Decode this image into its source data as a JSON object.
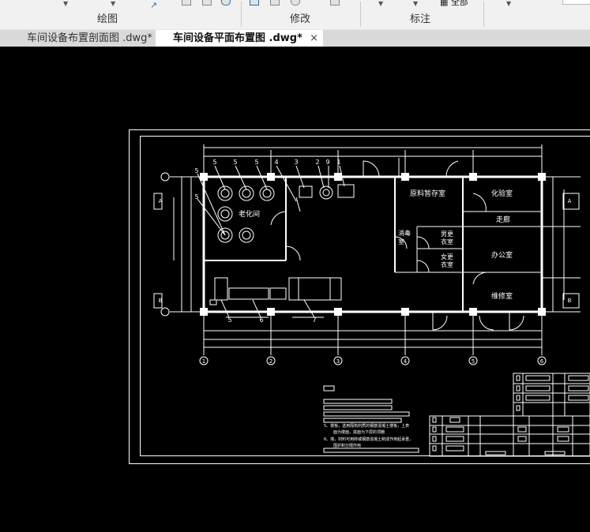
{
  "ribbon": {
    "groups": [
      {
        "label": "绘图"
      },
      {
        "label": "修改"
      },
      {
        "label": "标注"
      }
    ],
    "partial_text": "全部"
  },
  "tabs": [
    {
      "label": "车间设备布置剖面图 .dwg*",
      "active": false
    },
    {
      "label": "车间设备平面布置图 .dwg*",
      "active": true
    }
  ],
  "close_glyph": "×",
  "drawing": {
    "rooms": {
      "aging": "老化间",
      "raw_storage": "原料暂存室",
      "lab": "化验室",
      "corridor": "走廊",
      "disinfect": "消毒\n室",
      "male_changing": "男更\n衣室",
      "female_changing": "女更\n衣室",
      "office": "办公室",
      "maintenance": "维修室"
    },
    "axis_numbers": [
      "1",
      "2",
      "3",
      "4",
      "5",
      "6"
    ],
    "axis_letters": [
      "A",
      "B"
    ],
    "callouts_top": [
      "5",
      "5",
      "5",
      "4",
      "3",
      "2",
      "9",
      "1"
    ],
    "callouts_bottom": [
      "5",
      "6",
      "7"
    ],
    "callouts_left": [
      "5",
      "5"
    ],
    "notes": [
      "5、楼板，选用隔热材质的钢筋混凝土楼板，上表",
      "面为楼面，底面为下层的顶棚",
      "6、墙，材料可用砖或钢筋混凝土制成作用起承重，",
      "围护和分隔作用"
    ],
    "colors": {
      "background": "#000000",
      "lines": "#ffffff",
      "ribbon": "#f1f1f1",
      "tabbar": "#d9d9d9"
    }
  }
}
